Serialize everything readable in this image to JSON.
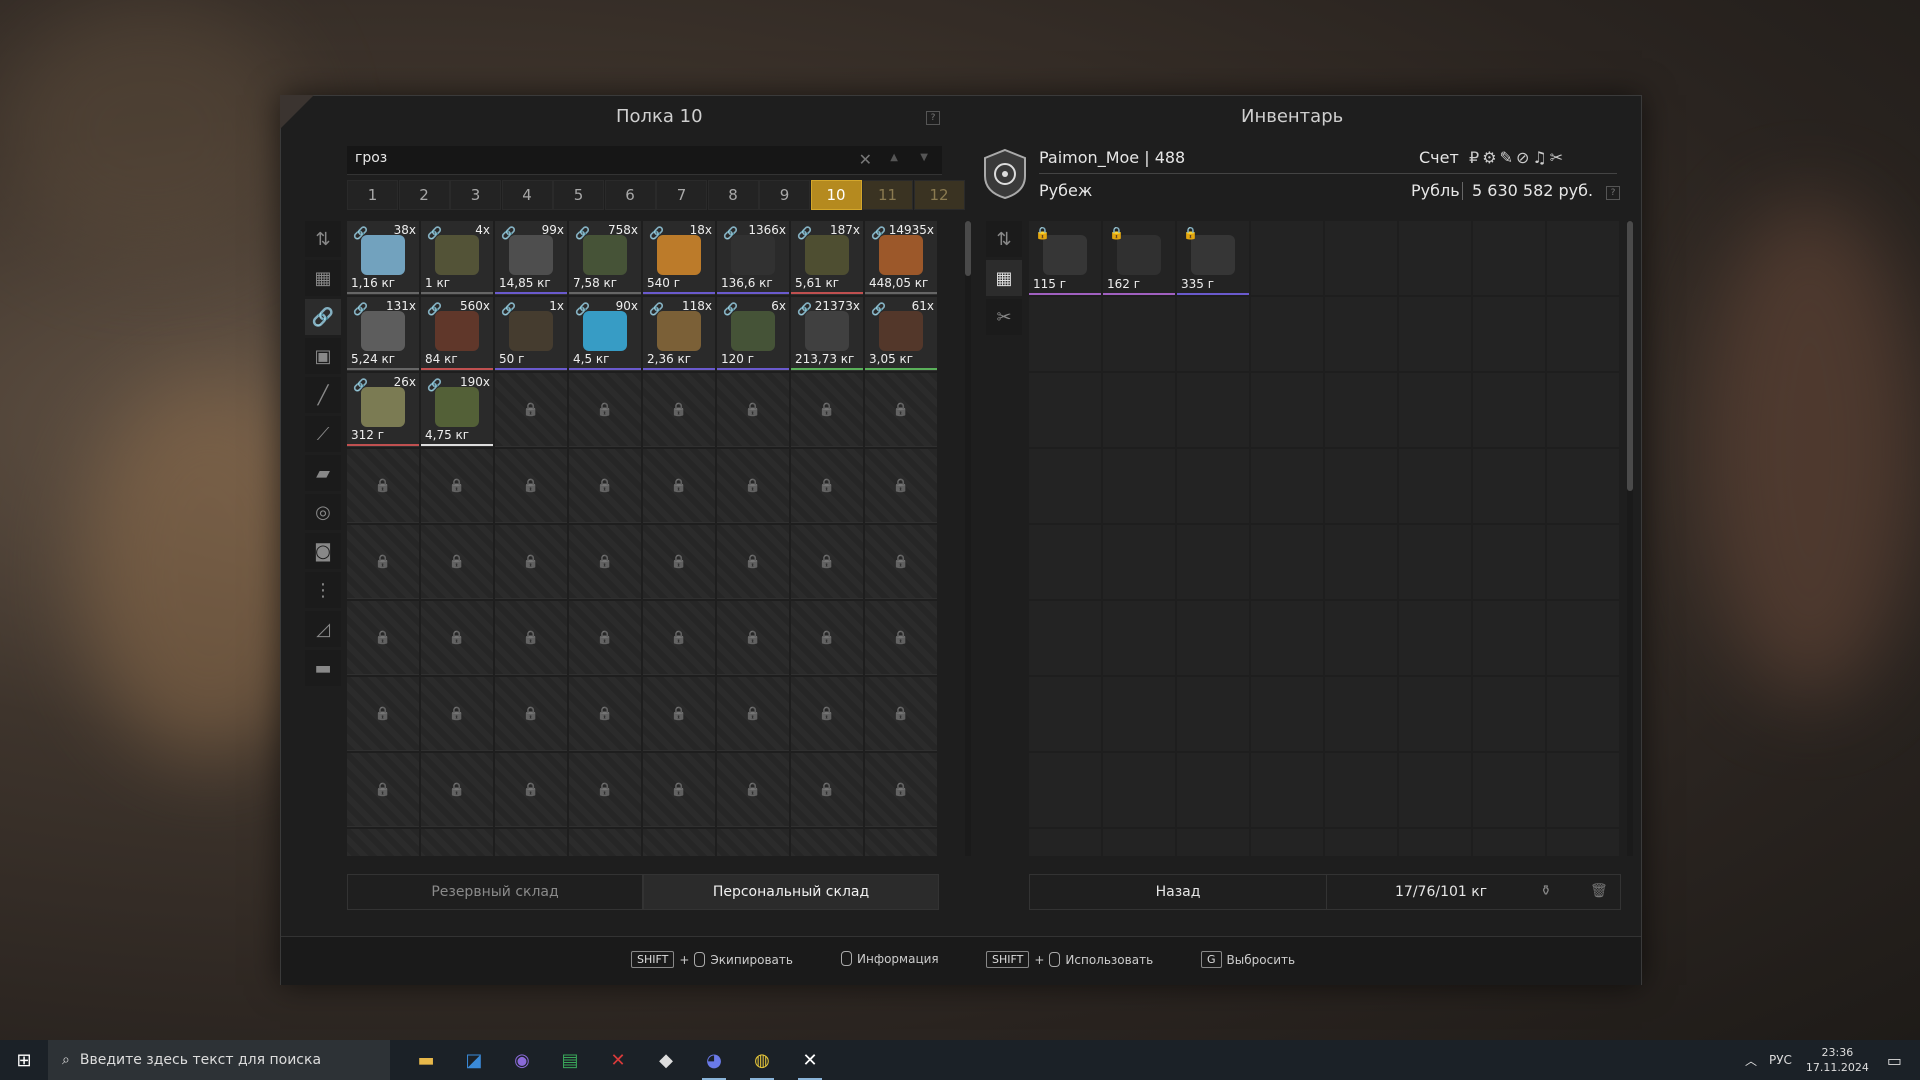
{
  "left_panel": {
    "title": "Полка 10",
    "help": "?",
    "search_value": "гроз",
    "clear_icon": "close-icon",
    "shelf_tabs": [
      "1",
      "2",
      "3",
      "4",
      "5",
      "6",
      "7",
      "8",
      "9",
      "10",
      "11",
      "12"
    ],
    "active_shelf": "10",
    "items": [
      {
        "qty": "38x",
        "weight": "1,16 кг",
        "color": "#7fb7d8",
        "bar": "#666"
      },
      {
        "qty": "4x",
        "weight": "1 кг",
        "color": "#5a5a3a",
        "bar": "#666"
      },
      {
        "qty": "99x",
        "weight": "14,85 кг",
        "color": "#555",
        "bar": "#6a5acd"
      },
      {
        "qty": "758x",
        "weight": "7,58 кг",
        "color": "#4b5a3a",
        "bar": "#666"
      },
      {
        "qty": "18x",
        "weight": "540 г",
        "color": "#d68a2a",
        "bar": "#6a5acd"
      },
      {
        "qty": "1366x",
        "weight": "136,6 кг",
        "color": "#333",
        "bar": "#6a5acd"
      },
      {
        "qty": "187x",
        "weight": "5,61 кг",
        "color": "#553",
        "bar": "#c05050"
      },
      {
        "qty": "14935x",
        "weight": "448,05 кг",
        "color": "#b0602a",
        "bar": "#666"
      },
      {
        "qty": "131x",
        "weight": "5,24 кг",
        "color": "#666",
        "bar": "#666"
      },
      {
        "qty": "560x",
        "weight": "84 кг",
        "color": "#6a3a2a",
        "bar": "#c05050"
      },
      {
        "qty": "1x",
        "weight": "50 г",
        "color": "#4a4030",
        "bar": "#6a5acd"
      },
      {
        "qty": "90x",
        "weight": "4,5 кг",
        "color": "#3ab0e0",
        "bar": "#6a5acd"
      },
      {
        "qty": "118x",
        "weight": "2,36 кг",
        "color": "#8a6a3a",
        "bar": "#6a5acd"
      },
      {
        "qty": "6x",
        "weight": "120 г",
        "color": "#4a5a3a",
        "bar": "#6a5acd"
      },
      {
        "qty": "21373x",
        "weight": "213,73 кг",
        "color": "#444",
        "bar": "#5ab05a"
      },
      {
        "qty": "61x",
        "weight": "3,05 кг",
        "color": "#5a3a2a",
        "bar": "#5ab05a"
      },
      {
        "qty": "26x",
        "weight": "312 г",
        "color": "#8a8a5a",
        "bar": "#c05050"
      },
      {
        "qty": "190x",
        "weight": "4,75 кг",
        "color": "#5a6a3a",
        "bar": "#ddd"
      }
    ],
    "storage_tabs": {
      "reserve": "Резервный склад",
      "personal": "Персональный склад"
    }
  },
  "right_panel": {
    "title": "Инвентарь",
    "help": "?",
    "player": "Paimon_Moe | 488",
    "faction": "Рубеж",
    "account_label": "Счет",
    "currency_label": "Рубль",
    "currency_value": "5 630 582 руб.",
    "currency_icons": [
      "₽",
      "⚙",
      "✎",
      "⊘",
      "♫",
      "✂"
    ],
    "items": [
      {
        "weight": "115 г",
        "color": "#3a3a3a",
        "bar": "#a060c0"
      },
      {
        "weight": "162 г",
        "color": "#333",
        "bar": "#a060c0"
      },
      {
        "weight": "335 г",
        "color": "#3a3a3a",
        "bar": "#6a5acd"
      }
    ],
    "back": "Назад",
    "weight_status": "17/76/101 кг"
  },
  "hints": {
    "shift1": "SHIFT",
    "plus1": "+",
    "equip": "Экипировать",
    "info": "Информация",
    "shift2": "SHIFT",
    "plus2": "+",
    "use": "Использовать",
    "gkey": "G",
    "drop": "Выбросить"
  },
  "taskbar": {
    "search_placeholder": "Введите здесь текст для поиска",
    "lang": "РУС",
    "time": "23:36",
    "date": "17.11.2024"
  }
}
